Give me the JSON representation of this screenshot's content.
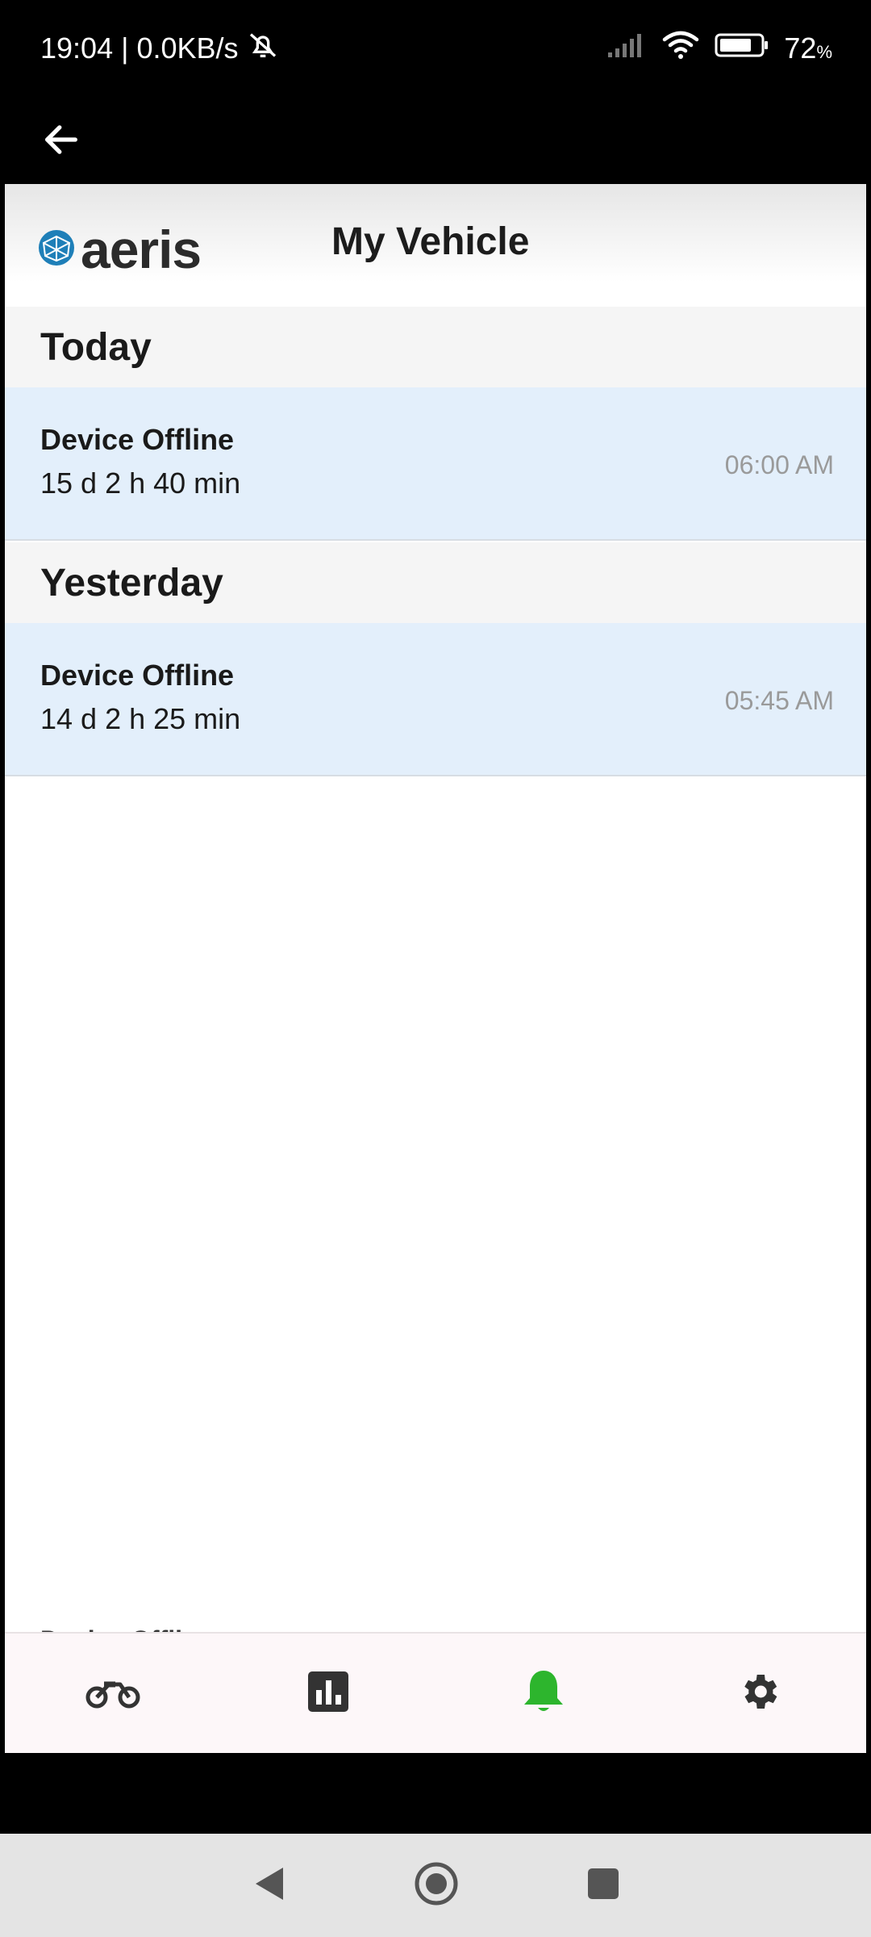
{
  "status_bar": {
    "time": "19:04",
    "separator": "|",
    "network_speed": "0.0KB/s",
    "battery": "72",
    "battery_unit": "%"
  },
  "header": {
    "logo_text": "aeris",
    "title": "My Vehicle"
  },
  "sections": [
    {
      "label": "Today",
      "items": [
        {
          "title": "Device Offline",
          "duration": "15 d 2 h 40 min",
          "time": "06:00 AM"
        }
      ]
    },
    {
      "label": "Yesterday",
      "items": [
        {
          "title": "Device Offline",
          "duration": "14 d 2 h 25 min",
          "time": "05:45 AM"
        }
      ]
    }
  ],
  "peek_text": "Device Offline",
  "bottom_nav": [
    {
      "name": "vehicle",
      "icon": "motorcycle-icon",
      "active": false
    },
    {
      "name": "stats",
      "icon": "bar-chart-icon",
      "active": false
    },
    {
      "name": "alerts",
      "icon": "bell-icon",
      "active": true
    },
    {
      "name": "settings",
      "icon": "gear-icon",
      "active": false
    }
  ],
  "colors": {
    "active_nav": "#2db52d",
    "inactive_nav": "#333333",
    "row_bg": "#e3effb",
    "section_bg": "#f5f5f5",
    "logo_blue": "#1e7fb8"
  }
}
